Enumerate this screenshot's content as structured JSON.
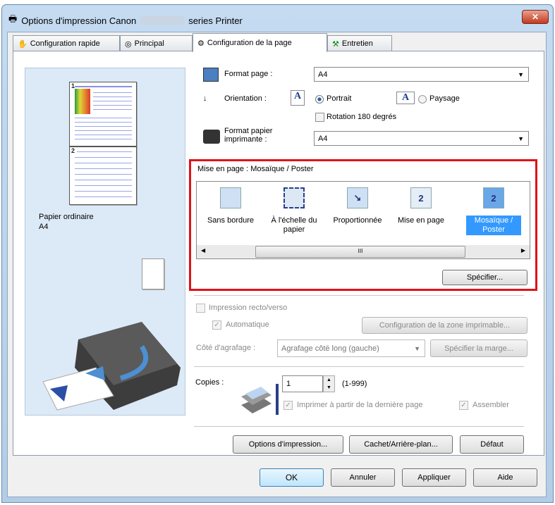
{
  "window": {
    "title_prefix": "Options d'impression Canon",
    "title_suffix": "series Printer",
    "close": "✕"
  },
  "tabs": [
    {
      "label": "Configuration rapide"
    },
    {
      "label": "Principal"
    },
    {
      "label": "Configuration de la page",
      "active": true
    },
    {
      "label": "Entretien"
    }
  ],
  "preview": {
    "page1_number": "1",
    "page2_number": "2",
    "paper_type": "Papier ordinaire",
    "paper_size": "A4"
  },
  "page_setup": {
    "page_size_label": "Format page :",
    "page_size_value": "A4",
    "orientation_label": "Orientation :",
    "portrait_label": "Portrait",
    "landscape_label": "Paysage",
    "orientation_selected": "Portrait",
    "rotation_label": "Rotation 180 degrés",
    "rotation_checked": false,
    "printer_paper_label_1": "Format papier",
    "printer_paper_label_2": "imprimante :",
    "printer_paper_value": "A4"
  },
  "layout": {
    "label": "Mise en page :",
    "value": "Mosaïque / Poster",
    "items": [
      {
        "label": "Sans bordure",
        "icon": "borderless-icon"
      },
      {
        "label": "À l'échelle du papier",
        "icon": "fit-to-page-icon"
      },
      {
        "label": "Proportionnée",
        "icon": "scaled-icon"
      },
      {
        "label": "Mise en page",
        "icon": "page-layout-icon",
        "glyph": "2"
      },
      {
        "label": "Mosaïque / Poster",
        "icon": "tiling-poster-icon",
        "glyph": "2",
        "selected": true
      }
    ],
    "scroll_grip": "III",
    "specify_button": "Spécifier..."
  },
  "duplex": {
    "label": "Impression recto/verso",
    "checked": false,
    "auto_label": "Automatique",
    "auto_checked": true,
    "print_area_button": "Configuration de la zone imprimable...",
    "stapling_label": "Côté d'agrafage :",
    "stapling_value": "Agrafage côté long (gauche)",
    "margin_button": "Spécifier la marge..."
  },
  "copies": {
    "label": "Copies :",
    "value": "1",
    "range": "(1-999)",
    "reverse_label": "Imprimer à partir de la dernière page",
    "reverse_checked": true,
    "collate_label": "Assembler",
    "collate_checked": true
  },
  "panel_buttons": {
    "print_options": "Options d'impression...",
    "stamp": "Cachet/Arrière-plan...",
    "defaults": "Défaut"
  },
  "dialog_buttons": {
    "ok": "OK",
    "cancel": "Annuler",
    "apply": "Appliquer",
    "help": "Aide"
  },
  "colors": {
    "highlight_border": "#e0121a",
    "selection": "#3399ff",
    "preview_bg": "#dce9f7"
  }
}
